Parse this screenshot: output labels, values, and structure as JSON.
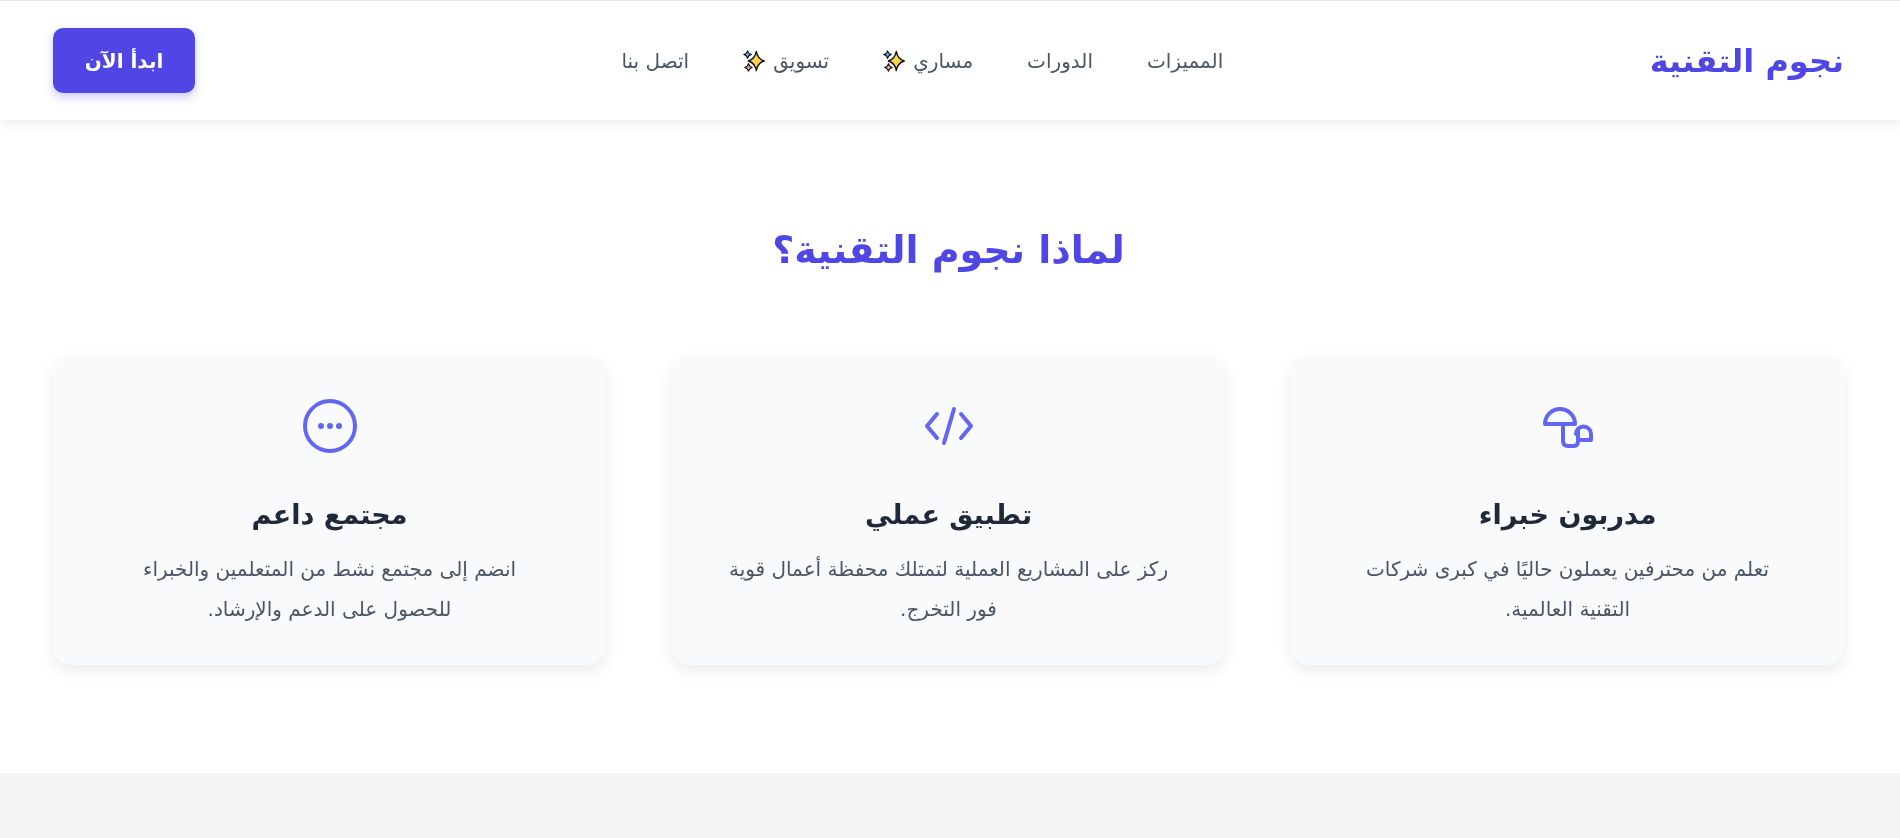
{
  "header": {
    "logo": "نجوم التقنية",
    "nav": [
      {
        "label": "المميزات",
        "kind": "plain"
      },
      {
        "label": "الدورات",
        "kind": "plain"
      },
      {
        "label": "مساري",
        "kind": "highlighted"
      },
      {
        "label": "تسويق",
        "kind": "highlighted"
      },
      {
        "label": "اتصل بنا",
        "kind": "plain"
      }
    ],
    "cta": "ابدأ الآن"
  },
  "features": {
    "title": "لماذا نجوم التقنية؟",
    "cards": [
      {
        "kind": "experts",
        "title": "مدربون خبراء",
        "text": "تعلم من محترفين يعملون حاليًا في كبرى شركات التقنية العالمية."
      },
      {
        "kind": "practice",
        "title": "تطبيق عملي",
        "text": "ركز على المشاريع العملية لتمتلك محفظة أعمال قوية فور التخرج."
      },
      {
        "kind": "community",
        "title": "مجتمع داعم",
        "text": "انضم إلى مجتمع نشط من المتعلمين والخبراء للحصول على الدعم والإرشاد."
      }
    ]
  }
}
